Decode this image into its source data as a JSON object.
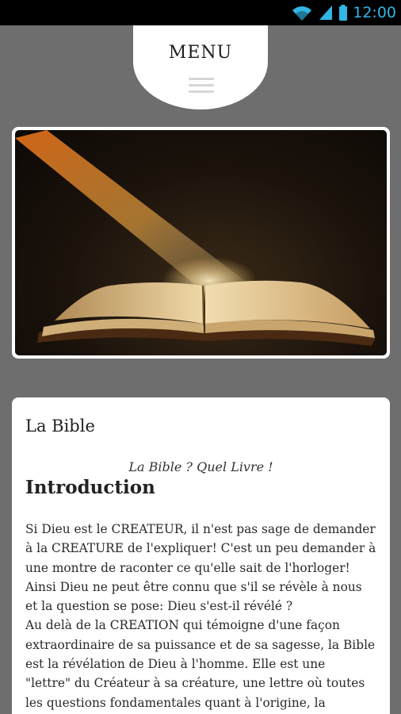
{
  "status_bar": {
    "time": "12:00",
    "icons": [
      "wifi-icon",
      "signal-icon",
      "battery-icon"
    ],
    "accent_color": "#33b5e5"
  },
  "menu": {
    "label": "MENU",
    "icon": "hamburger-icon"
  },
  "hero": {
    "image": "open-bible-with-light-ray"
  },
  "content": {
    "title": "La Bible",
    "subtitle": "La Bible ? Quel Livre !",
    "heading": "Introduction",
    "lines": [
      "Si Dieu est le CREATEUR, il n'est pas sage de demander",
      "à la CREATURE de l'expliquer! C'est un peu demander à",
      "une montre de raconter ce qu'elle sait de l'horloger!",
      "Ainsi Dieu ne peut être connu que s'il se révèle à nous",
      "et la question se pose: Dieu s'est-il révélé ?",
      "Au delà de la CREATION qui témoigne d'une façon",
      "extraordinaire de sa puissance et de sa sagesse, la Bible",
      "est la révélation de Dieu à l'homme. Elle est une",
      "\"lettre\" du Créateur à sa créature, une lettre où toutes",
      "les questions fondamentales quant à l'origine, la"
    ]
  }
}
